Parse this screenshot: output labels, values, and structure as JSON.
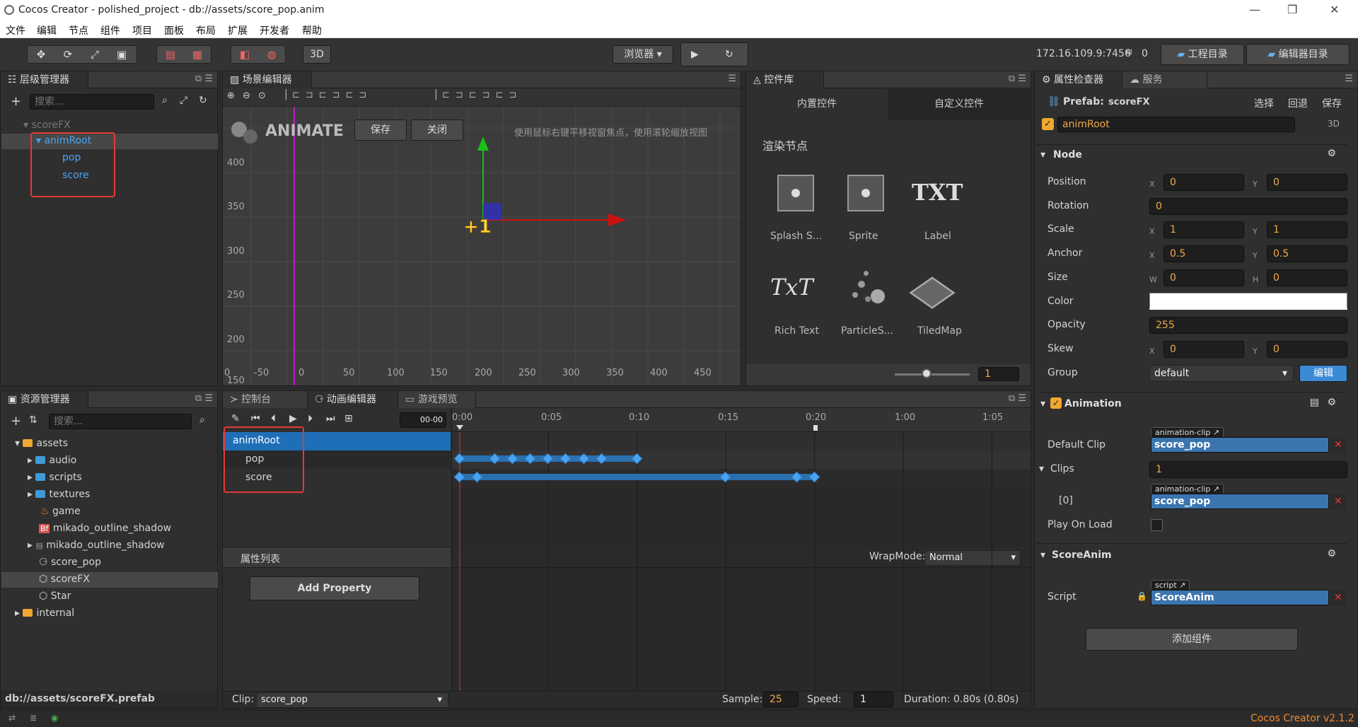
{
  "window": {
    "title": "Cocos Creator - polished_project - db://assets/score_pop.anim"
  },
  "menu": [
    "文件",
    "编辑",
    "节点",
    "组件",
    "项目",
    "面板",
    "布局",
    "扩展",
    "开发者",
    "帮助"
  ],
  "toolbar": {
    "mode3d": "3D",
    "browser": "浏览器",
    "ip": "172.16.109.9:7456",
    "wifi_count": "0",
    "project_dir": "工程目录",
    "editor_dir": "编辑器目录"
  },
  "hierarchy": {
    "tab": "层级管理器",
    "search_placeholder": "搜索...",
    "root": "scoreFX",
    "animRoot": "animRoot",
    "pop": "pop",
    "score": "score"
  },
  "scene": {
    "tab": "场景编辑器",
    "animate": "ANIMATE",
    "save": "保存",
    "close": "关闭",
    "hint": "使用鼠标右键平移视窗焦点，使用滚轮缩放视图",
    "y_ticks": [
      "400",
      "350",
      "300",
      "250",
      "200",
      "150"
    ],
    "x_ticks": [
      "0",
      "-50",
      "0",
      "50",
      "100",
      "150",
      "200",
      "250",
      "300",
      "350",
      "400",
      "450"
    ]
  },
  "widgets": {
    "tab": "控件库",
    "builtin": "内置控件",
    "custom": "自定义控件",
    "section": "渲染节点",
    "items": [
      "Splash S...",
      "Sprite",
      "Label",
      "Rich Text",
      "ParticleS...",
      "TiledMap"
    ],
    "zoom": "1"
  },
  "assets": {
    "tab": "资源管理器",
    "search_placeholder": "搜索...",
    "items": [
      "assets",
      "audio",
      "scripts",
      "textures",
      "game",
      "mikado_outline_shadow",
      "mikado_outline_shadow",
      "score_pop",
      "scoreFX",
      "Star",
      "internal"
    ],
    "path": "db://assets/scoreFX.prefab"
  },
  "bottom_tabs": {
    "console": "控制台",
    "anim": "动画编辑器",
    "preview": "游戏预览"
  },
  "anim": {
    "time": "00-00",
    "nodes": [
      "animRoot",
      "pop",
      "score"
    ],
    "ruler": [
      "0:00",
      "0:05",
      "0:10",
      "0:15",
      "0:20",
      "1:00",
      "1:05"
    ],
    "props_title": "属性列表",
    "wrap_label": "WrapMode:",
    "wrap_value": "Normal",
    "add_property": "Add Property",
    "clip_label": "Clip:",
    "clip_value": "score_pop",
    "sample_label": "Sample:",
    "sample_value": "25",
    "speed_label": "Speed:",
    "speed_value": "1",
    "duration": "Duration: 0.80s (0.80s)"
  },
  "inspector": {
    "tab": "属性检查器",
    "tab2": "服务",
    "prefab_label": "Prefab:",
    "prefab_name": "scoreFX",
    "select": "选择",
    "revert": "回退",
    "save": "保存",
    "node_name": "animRoot",
    "mode": "3D",
    "node_section": "Node",
    "position": "Position",
    "pos_x": "0",
    "pos_y": "0",
    "rotation": "Rotation",
    "rot": "0",
    "scale": "Scale",
    "scale_x": "1",
    "scale_y": "1",
    "anchor": "Anchor",
    "anchor_x": "0.5",
    "anchor_y": "0.5",
    "size": "Size",
    "size_w": "0",
    "size_h": "0",
    "color": "Color",
    "color_value": "#ffffff",
    "opacity": "Opacity",
    "opacity_value": "255",
    "skew": "Skew",
    "skew_x": "0",
    "skew_y": "0",
    "group": "Group",
    "group_value": "default",
    "edit": "编辑",
    "anim_section": "Animation",
    "default_clip": "Default Clip",
    "clip_type": "animation-clip",
    "clip_name": "score_pop",
    "clips": "Clips",
    "clips_count": "1",
    "clip_index": "[0]",
    "play_on_load": "Play On Load",
    "score_section": "ScoreAnim",
    "script": "Script",
    "script_type": "script",
    "script_name": "ScoreAnim",
    "add_component": "添加组件",
    "x": "X",
    "y": "Y",
    "w": "W",
    "h": "H"
  },
  "status": {
    "version": "Cocos Creator v2.1.2"
  }
}
